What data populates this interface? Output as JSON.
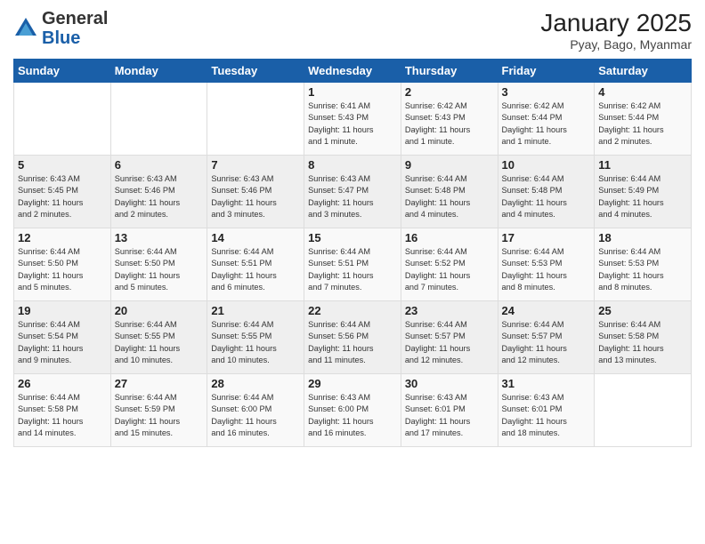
{
  "logo": {
    "general": "General",
    "blue": "Blue"
  },
  "header": {
    "month": "January 2025",
    "location": "Pyay, Bago, Myanmar"
  },
  "days_of_week": [
    "Sunday",
    "Monday",
    "Tuesday",
    "Wednesday",
    "Thursday",
    "Friday",
    "Saturday"
  ],
  "weeks": [
    [
      {
        "day": "",
        "info": ""
      },
      {
        "day": "",
        "info": ""
      },
      {
        "day": "",
        "info": ""
      },
      {
        "day": "1",
        "info": "Sunrise: 6:41 AM\nSunset: 5:43 PM\nDaylight: 11 hours\nand 1 minute."
      },
      {
        "day": "2",
        "info": "Sunrise: 6:42 AM\nSunset: 5:43 PM\nDaylight: 11 hours\nand 1 minute."
      },
      {
        "day": "3",
        "info": "Sunrise: 6:42 AM\nSunset: 5:44 PM\nDaylight: 11 hours\nand 1 minute."
      },
      {
        "day": "4",
        "info": "Sunrise: 6:42 AM\nSunset: 5:44 PM\nDaylight: 11 hours\nand 2 minutes."
      }
    ],
    [
      {
        "day": "5",
        "info": "Sunrise: 6:43 AM\nSunset: 5:45 PM\nDaylight: 11 hours\nand 2 minutes."
      },
      {
        "day": "6",
        "info": "Sunrise: 6:43 AM\nSunset: 5:46 PM\nDaylight: 11 hours\nand 2 minutes."
      },
      {
        "day": "7",
        "info": "Sunrise: 6:43 AM\nSunset: 5:46 PM\nDaylight: 11 hours\nand 3 minutes."
      },
      {
        "day": "8",
        "info": "Sunrise: 6:43 AM\nSunset: 5:47 PM\nDaylight: 11 hours\nand 3 minutes."
      },
      {
        "day": "9",
        "info": "Sunrise: 6:44 AM\nSunset: 5:48 PM\nDaylight: 11 hours\nand 4 minutes."
      },
      {
        "day": "10",
        "info": "Sunrise: 6:44 AM\nSunset: 5:48 PM\nDaylight: 11 hours\nand 4 minutes."
      },
      {
        "day": "11",
        "info": "Sunrise: 6:44 AM\nSunset: 5:49 PM\nDaylight: 11 hours\nand 4 minutes."
      }
    ],
    [
      {
        "day": "12",
        "info": "Sunrise: 6:44 AM\nSunset: 5:50 PM\nDaylight: 11 hours\nand 5 minutes."
      },
      {
        "day": "13",
        "info": "Sunrise: 6:44 AM\nSunset: 5:50 PM\nDaylight: 11 hours\nand 5 minutes."
      },
      {
        "day": "14",
        "info": "Sunrise: 6:44 AM\nSunset: 5:51 PM\nDaylight: 11 hours\nand 6 minutes."
      },
      {
        "day": "15",
        "info": "Sunrise: 6:44 AM\nSunset: 5:51 PM\nDaylight: 11 hours\nand 7 minutes."
      },
      {
        "day": "16",
        "info": "Sunrise: 6:44 AM\nSunset: 5:52 PM\nDaylight: 11 hours\nand 7 minutes."
      },
      {
        "day": "17",
        "info": "Sunrise: 6:44 AM\nSunset: 5:53 PM\nDaylight: 11 hours\nand 8 minutes."
      },
      {
        "day": "18",
        "info": "Sunrise: 6:44 AM\nSunset: 5:53 PM\nDaylight: 11 hours\nand 8 minutes."
      }
    ],
    [
      {
        "day": "19",
        "info": "Sunrise: 6:44 AM\nSunset: 5:54 PM\nDaylight: 11 hours\nand 9 minutes."
      },
      {
        "day": "20",
        "info": "Sunrise: 6:44 AM\nSunset: 5:55 PM\nDaylight: 11 hours\nand 10 minutes."
      },
      {
        "day": "21",
        "info": "Sunrise: 6:44 AM\nSunset: 5:55 PM\nDaylight: 11 hours\nand 10 minutes."
      },
      {
        "day": "22",
        "info": "Sunrise: 6:44 AM\nSunset: 5:56 PM\nDaylight: 11 hours\nand 11 minutes."
      },
      {
        "day": "23",
        "info": "Sunrise: 6:44 AM\nSunset: 5:57 PM\nDaylight: 11 hours\nand 12 minutes."
      },
      {
        "day": "24",
        "info": "Sunrise: 6:44 AM\nSunset: 5:57 PM\nDaylight: 11 hours\nand 12 minutes."
      },
      {
        "day": "25",
        "info": "Sunrise: 6:44 AM\nSunset: 5:58 PM\nDaylight: 11 hours\nand 13 minutes."
      }
    ],
    [
      {
        "day": "26",
        "info": "Sunrise: 6:44 AM\nSunset: 5:58 PM\nDaylight: 11 hours\nand 14 minutes."
      },
      {
        "day": "27",
        "info": "Sunrise: 6:44 AM\nSunset: 5:59 PM\nDaylight: 11 hours\nand 15 minutes."
      },
      {
        "day": "28",
        "info": "Sunrise: 6:44 AM\nSunset: 6:00 PM\nDaylight: 11 hours\nand 16 minutes."
      },
      {
        "day": "29",
        "info": "Sunrise: 6:43 AM\nSunset: 6:00 PM\nDaylight: 11 hours\nand 16 minutes."
      },
      {
        "day": "30",
        "info": "Sunrise: 6:43 AM\nSunset: 6:01 PM\nDaylight: 11 hours\nand 17 minutes."
      },
      {
        "day": "31",
        "info": "Sunrise: 6:43 AM\nSunset: 6:01 PM\nDaylight: 11 hours\nand 18 minutes."
      },
      {
        "day": "",
        "info": ""
      }
    ]
  ]
}
